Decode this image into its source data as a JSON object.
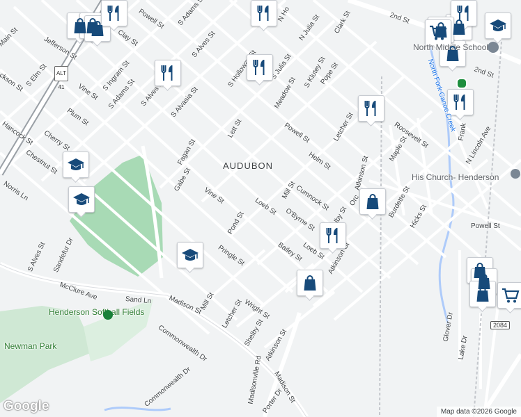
{
  "area_label": "AUDUBON",
  "attribution": "Map data ©2026 Google",
  "logo": "Google",
  "places": {
    "softball": "Henderson Softball Fields",
    "newman": "Newman Park",
    "school": "North Middle School",
    "church": "His Church- Henderson",
    "creek": "North Fork Canoe Creek"
  },
  "shields": {
    "alt41": "ALT 41",
    "r2084": "2084"
  },
  "streets": [
    {
      "t": "Main St"
    },
    {
      "t": "Jefferson St"
    },
    {
      "t": "ckson St"
    },
    {
      "t": "S Elm St"
    },
    {
      "t": "Vine St"
    },
    {
      "t": "Plum St"
    },
    {
      "t": "Hancock St"
    },
    {
      "t": "Cherry St"
    },
    {
      "t": "Chestnut St"
    },
    {
      "t": "Norris Ln"
    },
    {
      "t": "Clay St"
    },
    {
      "t": "S Ingram St"
    },
    {
      "t": "S Adams St"
    },
    {
      "t": "S Alves St"
    },
    {
      "t": "S Alvasia St"
    },
    {
      "t": "Powell St"
    },
    {
      "t": "S Adams St"
    },
    {
      "t": "S Alves St"
    },
    {
      "t": "Fagan St"
    },
    {
      "t": "Gabe St"
    },
    {
      "t": "Vine St"
    },
    {
      "t": "Lett St"
    },
    {
      "t": "S Holloway St"
    },
    {
      "t": "S Julia St"
    },
    {
      "t": "Meadow St"
    },
    {
      "t": "S Klutey St"
    },
    {
      "t": "Pope St"
    },
    {
      "t": "Powell St"
    },
    {
      "t": "Helm St"
    },
    {
      "t": "Letcher St"
    },
    {
      "t": "Atkinson St"
    },
    {
      "t": "Roosevelt St"
    },
    {
      "t": "Maple St"
    },
    {
      "t": "N Lincoln Ave"
    },
    {
      "t": "Burdette St"
    },
    {
      "t": "Hicks St"
    },
    {
      "t": "Powell St"
    },
    {
      "t": "Mill St"
    },
    {
      "t": "Cumnock St"
    },
    {
      "t": "Loeb St"
    },
    {
      "t": "O'Byrne St"
    },
    {
      "t": "Shelby St"
    },
    {
      "t": "Pond St"
    },
    {
      "t": "Pringle St"
    },
    {
      "t": "Bailey St"
    },
    {
      "t": "Loeb St"
    },
    {
      "t": "Atkinson St"
    },
    {
      "t": "S Alves St"
    },
    {
      "t": "Sandefur Dr"
    },
    {
      "t": "McClure Ave"
    },
    {
      "t": "Sand Ln"
    },
    {
      "t": "Madison St"
    },
    {
      "t": "Mill St"
    },
    {
      "t": "Letcher St"
    },
    {
      "t": "Wright St"
    },
    {
      "t": "Shelby St"
    },
    {
      "t": "Atkinson St"
    },
    {
      "t": "Commonwealth Dr"
    },
    {
      "t": "Commonwealth Dr"
    },
    {
      "t": "Madisonville Rd"
    },
    {
      "t": "Madison St"
    },
    {
      "t": "Porter Dr"
    },
    {
      "t": "2nd St"
    },
    {
      "t": "2nd St"
    },
    {
      "t": "N Julia St"
    },
    {
      "t": "Clark St"
    },
    {
      "t": "N Ho"
    },
    {
      "t": "Glover Dr"
    },
    {
      "t": "Lake Dr"
    },
    {
      "t": "Frank"
    },
    {
      "t": "Orc"
    }
  ],
  "pins": [
    {
      "type": "shopping"
    },
    {
      "type": "shopping"
    },
    {
      "type": "shopping"
    },
    {
      "type": "restaurant"
    },
    {
      "type": "restaurant"
    },
    {
      "type": "shopping"
    },
    {
      "type": "restaurant"
    },
    {
      "type": "restaurant"
    },
    {
      "type": "shopping"
    },
    {
      "type": "shopping"
    },
    {
      "type": "restaurant"
    },
    {
      "type": "school"
    },
    {
      "type": "restaurant"
    },
    {
      "type": "restaurant"
    },
    {
      "type": "school"
    },
    {
      "type": "school"
    },
    {
      "type": "shopping"
    },
    {
      "type": "restaurant"
    },
    {
      "type": "school"
    },
    {
      "type": "shopping"
    },
    {
      "type": "shopping"
    },
    {
      "type": "shopping"
    },
    {
      "type": "shopping"
    },
    {
      "type": "cart"
    },
    {
      "type": "cart"
    }
  ]
}
